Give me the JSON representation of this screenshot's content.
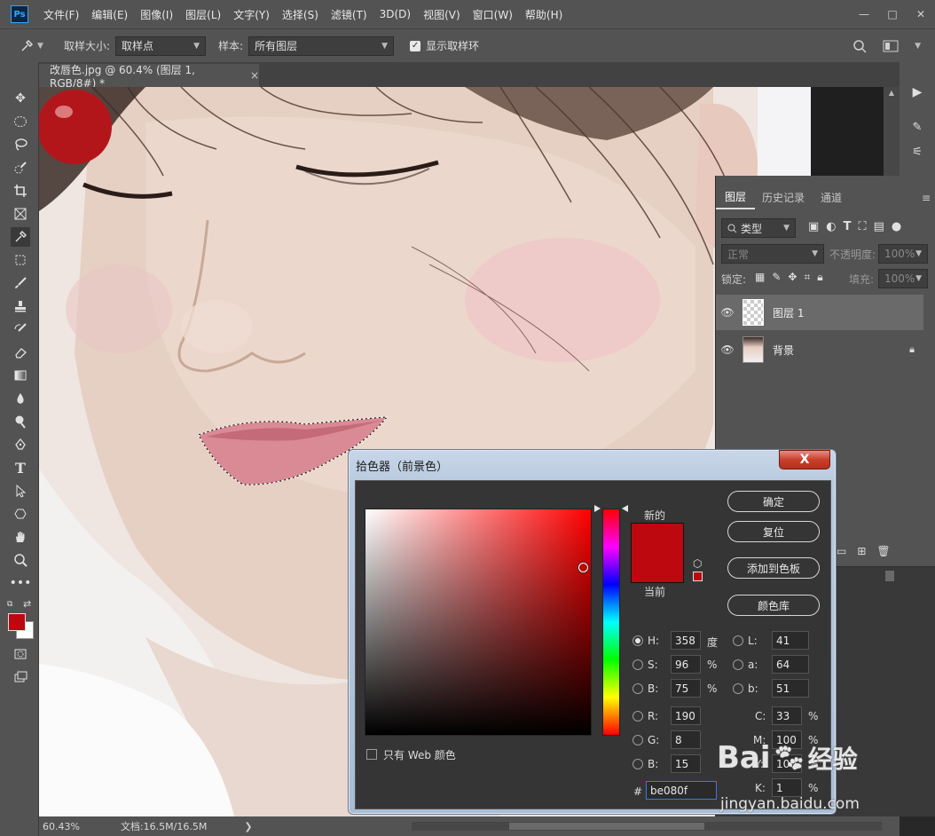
{
  "menubar": {
    "logo": "Ps",
    "items": [
      "文件(F)",
      "编辑(E)",
      "图像(I)",
      "图层(L)",
      "文字(Y)",
      "选择(S)",
      "滤镜(T)",
      "3D(D)",
      "视图(V)",
      "窗口(W)",
      "帮助(H)"
    ],
    "minimize": "—",
    "restore": "□",
    "close": "✕"
  },
  "options": {
    "sample_size_label": "取样大小:",
    "sample_size_value": "取样点",
    "sample_label": "样本:",
    "sample_value": "所有图层",
    "show_ring_label": "显示取样环"
  },
  "document": {
    "tab_title": "改唇色.jpg @ 60.4% (图层 1, RGB/8#) *",
    "tab_close": "×"
  },
  "status": {
    "zoom": "60.43%",
    "doc_size": "文档:16.5M/16.5M",
    "arrow": "❯"
  },
  "layers_panel": {
    "tabs": [
      "图层",
      "历史记录",
      "通道"
    ],
    "filter_label": "类型",
    "blend_mode": "正常",
    "opacity_label": "不透明度:",
    "opacity_value": "100%",
    "lock_label": "锁定:",
    "fill_label": "填充:",
    "fill_value": "100%",
    "layers": [
      {
        "name": "图层 1",
        "selected": true,
        "locked": false
      },
      {
        "name": "背景",
        "selected": false,
        "locked": true
      }
    ]
  },
  "color_picker": {
    "title": "拾色器（前景色）",
    "close": "X",
    "new_label": "新的",
    "current_label": "当前",
    "buttons": [
      "确定",
      "复位",
      "添加到色板",
      "颜色库"
    ],
    "web_only_label": "只有 Web 颜色",
    "fields": {
      "H": {
        "value": "358",
        "unit": "度"
      },
      "S": {
        "value": "96",
        "unit": "%"
      },
      "Bv": {
        "value": "75",
        "unit": "%"
      },
      "R": {
        "value": "190"
      },
      "G": {
        "value": "8"
      },
      "Bl": {
        "value": "15"
      },
      "L": {
        "value": "41"
      },
      "a": {
        "value": "64"
      },
      "b": {
        "value": "51"
      },
      "C": {
        "value": "33",
        "unit": "%"
      },
      "M": {
        "value": "100",
        "unit": "%"
      },
      "Y": {
        "value": "100",
        "unit": "%"
      },
      "K": {
        "value": "1",
        "unit": "%"
      }
    },
    "labels": {
      "H": "H:",
      "S": "S:",
      "Bv": "B:",
      "R": "R:",
      "G": "G:",
      "Bl": "B:",
      "L": "L:",
      "a": "a:",
      "b": "b:",
      "C": "C:",
      "M": "M:",
      "Y": "Y:",
      "K": "K:",
      "hash": "#"
    },
    "hex": "be080f",
    "new_color": "#be080f",
    "hue_base": "#ff0000"
  },
  "watermark": {
    "brand": "Bai",
    "brand_cn": "经验",
    "url": "jingyan.baidu.com"
  },
  "colors": {
    "foreground": "#be080f",
    "background": "#ffffff",
    "accent_blue": "#31a8ff"
  }
}
